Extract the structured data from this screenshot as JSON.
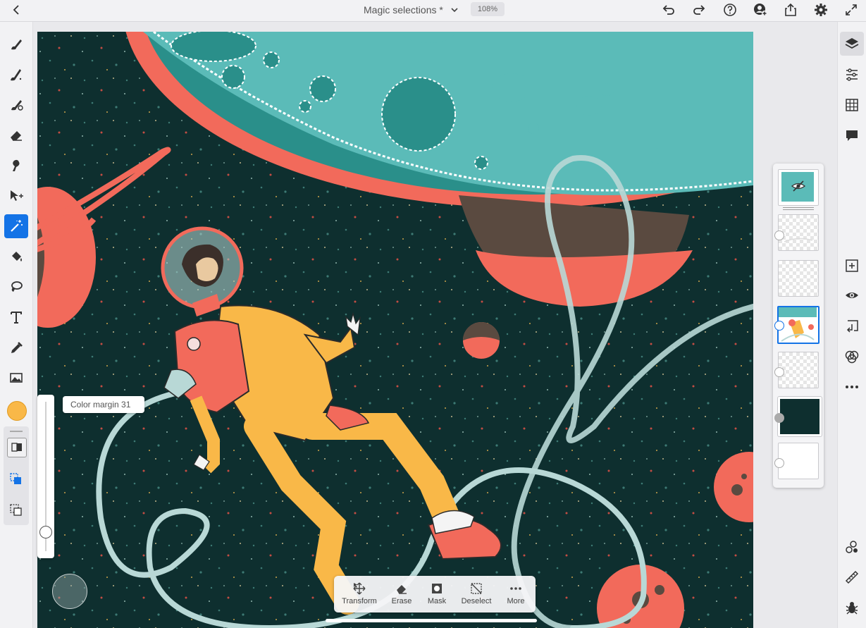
{
  "header": {
    "title": "Magic selections *",
    "zoom": "108%",
    "icons": [
      "back-icon",
      "chevron-down-icon",
      "undo-icon",
      "redo-icon",
      "help-icon",
      "add-user-icon",
      "share-icon",
      "settings-icon",
      "fullscreen-icon"
    ]
  },
  "left_toolbar": {
    "tools": [
      "brush-icon",
      "paint-brush-icon",
      "mixer-brush-icon",
      "eraser-icon",
      "smudge-icon",
      "move-icon",
      "magic-wand-icon",
      "paint-bucket-icon",
      "lasso-icon",
      "type-icon",
      "eyedropper-icon",
      "image-icon"
    ],
    "active_tool": "magic-wand-icon",
    "color_swatch": "#f9b848",
    "sub_tools": [
      "sample-layers-icon",
      "add-to-selection-icon",
      "subtract-from-selection-icon"
    ]
  },
  "slider": {
    "label": "Color margin 31",
    "value": 31
  },
  "right_toolbar": {
    "icons": [
      "layers-icon",
      "adjustments-icon",
      "grid-icon",
      "comments-icon",
      "add-layer-icon",
      "visibility-icon",
      "merge-down-icon",
      "blend-icon",
      "more-icon",
      "layer-properties-icon",
      "ruler-icon",
      "bug-icon"
    ]
  },
  "layers_panel": {
    "thumbnails": [
      "group-thumb",
      "transparent-thumb",
      "transparent-thumb",
      "artwork-thumb-selected",
      "transparent-thumb",
      "dark-fill-thumb",
      "white-fill-thumb"
    ]
  },
  "taskbar": {
    "transform": "Transform",
    "erase": "Erase",
    "mask": "Mask",
    "deselect": "Deselect",
    "more": "More"
  },
  "colors": {
    "accent": "#1473e6",
    "space": "#0e2f2f",
    "planet_teal": "#5bbbb8",
    "coral": "#f26a5b",
    "suit_yellow": "#f9b848"
  }
}
